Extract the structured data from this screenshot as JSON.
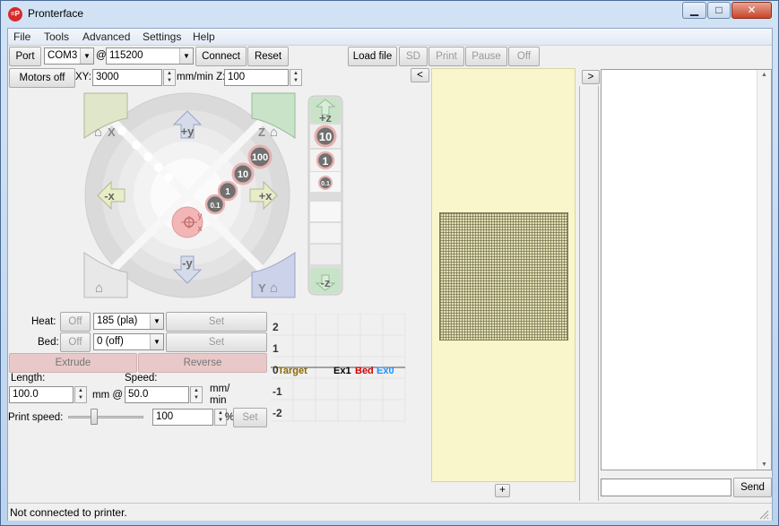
{
  "window": {
    "title": "Pronterface",
    "min_glyph": "▁",
    "max_glyph": "□",
    "close_glyph": "✕",
    "icon_text": "=P"
  },
  "menu": [
    "File",
    "Tools",
    "Advanced",
    "Settings",
    "Help"
  ],
  "toolbar": {
    "port_label": "Port",
    "port_value": "COM3",
    "at_label": "@",
    "baud_value": "115200",
    "connect_label": "Connect",
    "reset_label": "Reset",
    "load_file_label": "Load file",
    "sd_label": "SD",
    "print_label": "Print",
    "pause_label": "Pause",
    "off_label": "Off",
    "motors_off_label": "Motors off",
    "xy_label": "XY:",
    "xy_value": "3000",
    "mm_min_z_label": "mm/min Z:",
    "z_value": "100"
  },
  "jog": {
    "home_x": "X",
    "home_z": "Z",
    "home_y": "Y",
    "plus_y": "+y",
    "minus_y": "-y",
    "plus_x": "+x",
    "minus_x": "-x",
    "step_100": "100",
    "step_10": "10",
    "step_1": "1",
    "step_01": "0.1",
    "center_y": "y",
    "center_x": "x",
    "plus_z": "+z",
    "minus_z": "-z",
    "z_10": "10",
    "z_1": "1",
    "z_01": "0.1"
  },
  "temps": {
    "heat_label": "Heat:",
    "heat_off": "Off",
    "heat_value": "185 (pla)",
    "heat_set": "Set",
    "bed_label": "Bed:",
    "bed_off": "Off",
    "bed_value": "0 (off)",
    "bed_set": "Set",
    "extrude_label": "Extrude",
    "reverse_label": "Reverse",
    "length_label": "Length:",
    "length_value": "100.0",
    "mm_at_label": "mm @",
    "speed_label": "Speed:",
    "speed_value": "50.0",
    "mm_min_label_1": "mm/",
    "mm_min_label_2": "min",
    "print_speed_label": "Print speed:",
    "print_speed_value": "100",
    "percent_label": "%",
    "print_speed_set": "Set",
    "print_speed_fraction": 0.33
  },
  "graph": {
    "y_ticks": [
      "2",
      "1",
      "0",
      "-1",
      "-2"
    ],
    "legend": [
      {
        "name": "Target",
        "color": "#8a6a00"
      },
      {
        "name": "Ex1",
        "color": "#000000"
      },
      {
        "name": "Bed",
        "color": "#d00000"
      },
      {
        "name": "Ex0",
        "color": "#1e90ff"
      }
    ]
  },
  "panels": {
    "left_arrow": "<",
    "right_arrow": ">",
    "plus": "+",
    "send_label": "Send"
  },
  "status": {
    "text": "Not connected to printer."
  }
}
